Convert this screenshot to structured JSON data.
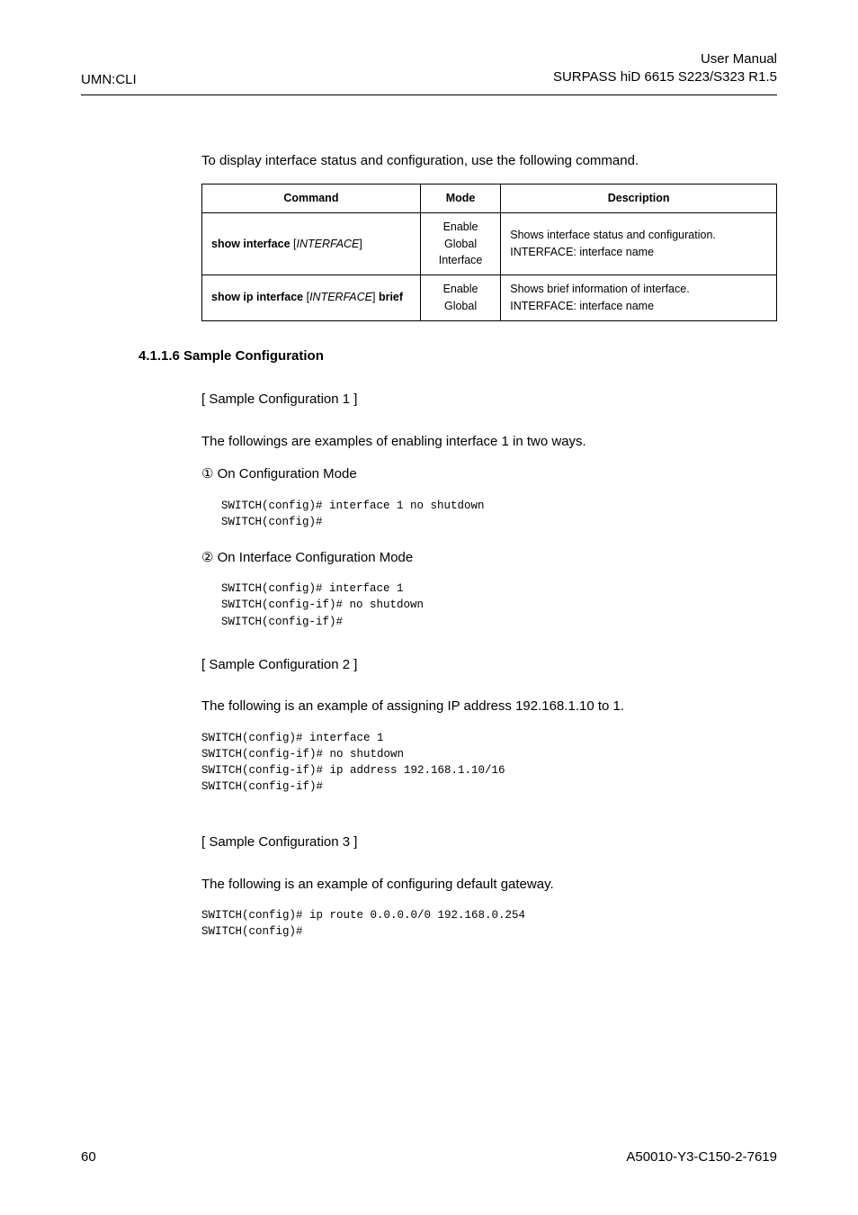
{
  "header": {
    "left": "UMN:CLI",
    "right_line1": "User Manual",
    "right_line2": "SURPASS hiD 6615 S223/S323 R1.5"
  },
  "intro": "To display interface status and configuration, use the following command.",
  "table": {
    "headers": {
      "command": "Command",
      "mode": "Mode",
      "description": "Description"
    },
    "rows": [
      {
        "command_parts": {
          "p1": "show interface ",
          "b1": "[",
          "i1": "INTERFACE",
          "b2": "]"
        },
        "modes": [
          "Enable",
          "Global",
          "Interface"
        ],
        "desc_line1": "Shows interface status and configuration.",
        "desc_line2": "INTERFACE: interface name"
      },
      {
        "command_parts": {
          "p1": "show ip interface ",
          "b1": "[",
          "i1": "INTERFACE",
          "b2": "]",
          "p2": " brief"
        },
        "modes": [
          "Enable",
          "Global"
        ],
        "desc_line1": "Shows brief information of interface.",
        "desc_line2": "INTERFACE: interface name"
      }
    ]
  },
  "subsection_title": "4.1.1.6   Sample Configuration",
  "sample1": {
    "label": "[ Sample Configuration 1 ]",
    "desc": "The followings are examples of enabling interface 1 in two ways.",
    "bullet1": "① On Configuration Mode",
    "code1_l1": "SWITCH(config)# interface 1 no shutdown",
    "code1_l2": "SWITCH(config)#",
    "bullet2": "② On Interface Configuration Mode",
    "code2_l1": "SWITCH(config)# interface 1",
    "code2_l2": "SWITCH(config-if)# no shutdown",
    "code2_l3": "SWITCH(config-if)#"
  },
  "sample2": {
    "label": "[ Sample Configuration 2 ]",
    "desc": "The following is an example of assigning IP address 192.168.1.10 to 1.",
    "code_l1": "SWITCH(config)# interface 1",
    "code_l2": "SWITCH(config-if)# no shutdown",
    "code_l3": "SWITCH(config-if)# ip address 192.168.1.10/16",
    "code_l4": "SWITCH(config-if)#"
  },
  "sample3": {
    "label": "[ Sample Configuration 3 ]",
    "desc": "The following is an example of configuring default gateway.",
    "code_l1": "SWITCH(config)# ip route 0.0.0.0/0 192.168.0.254",
    "code_l2": "SWITCH(config)#"
  },
  "footer": {
    "left": "60",
    "right": "A50010-Y3-C150-2-7619"
  }
}
